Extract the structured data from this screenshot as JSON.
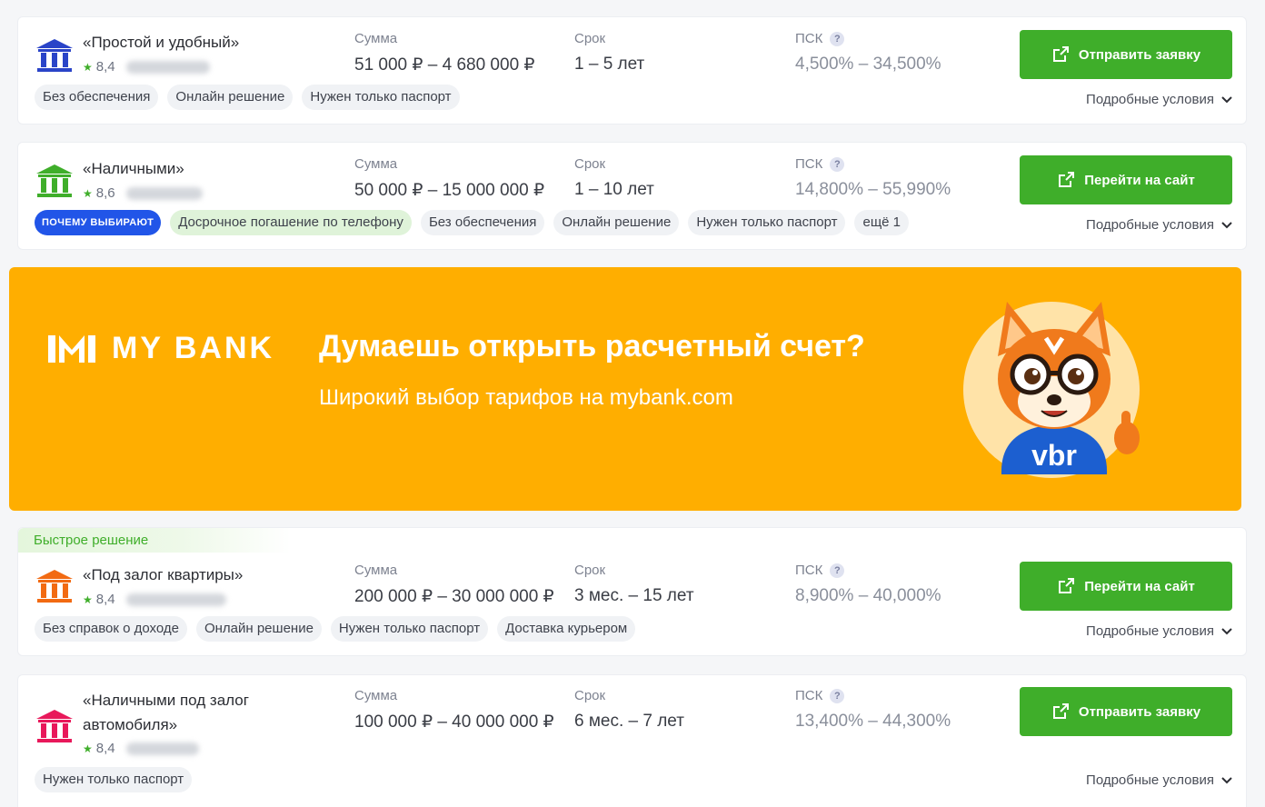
{
  "colors": {
    "accent_green": "#3fae2a",
    "banner_bg": "#ffae00",
    "badge_blue": "#2155e8"
  },
  "labels": {
    "sum": "Сумма",
    "term": "Срок",
    "psk": "ПСК",
    "details": "Подробные условия"
  },
  "offers": [
    {
      "icon_color": "#2a44c8",
      "name": "«Простой и удобный»",
      "rating": "8,4",
      "sum": "51 000 ₽ – 4 680 000 ₽",
      "term": "1 – 5 лет",
      "psk": "4,500% – 34,500%",
      "button": "Отправить заявку",
      "badge": "",
      "tags": [
        "Без обеспечения",
        "Онлайн решение",
        "Нужен только паспорт"
      ]
    },
    {
      "icon_color": "#3fae2a",
      "name": "«Наличными»",
      "rating": "8,6",
      "sum": "50 000 ₽ – 15 000 000 ₽",
      "term": "1 – 10 лет",
      "psk": "14,800% – 55,990%",
      "button": "Перейти на сайт",
      "badge": "ПОЧЕМУ ВЫБИРАЮТ",
      "highlight_tag": "Досрочное погашение по телефону",
      "tags": [
        "Без обеспечения",
        "Онлайн решение",
        "Нужен только паспорт",
        "ещё 1"
      ]
    },
    {
      "icon_color": "#f26a12",
      "top_label": "Быстрое решение",
      "name": "«Под залог квартиры»",
      "rating": "8,4",
      "sum": "200 000 ₽ – 30 000 000 ₽",
      "term": "3 мес. – 15 лет",
      "psk": "8,900% – 40,000%",
      "button": "Перейти на сайт",
      "tags": [
        "Без справок о доходе",
        "Онлайн решение",
        "Нужен только паспорт",
        "Доставка курьером"
      ]
    },
    {
      "icon_color": "#e8185a",
      "name": "«Наличными под залог автомобиля»",
      "rating": "8,4",
      "sum": "100 000 ₽ – 40 000 000 ₽",
      "term": "6 мес. – 7 лет",
      "psk": "13,400% – 44,300%",
      "button": "Отправить заявку",
      "tags": [
        "Нужен только паспорт"
      ]
    }
  ],
  "banner": {
    "logo_text": "MY BANK",
    "headline": "Думаешь открыть расчетный счет?",
    "subtitle": "Широкий выбор тарифов на mybank.com",
    "mascot_text": "vbr"
  }
}
